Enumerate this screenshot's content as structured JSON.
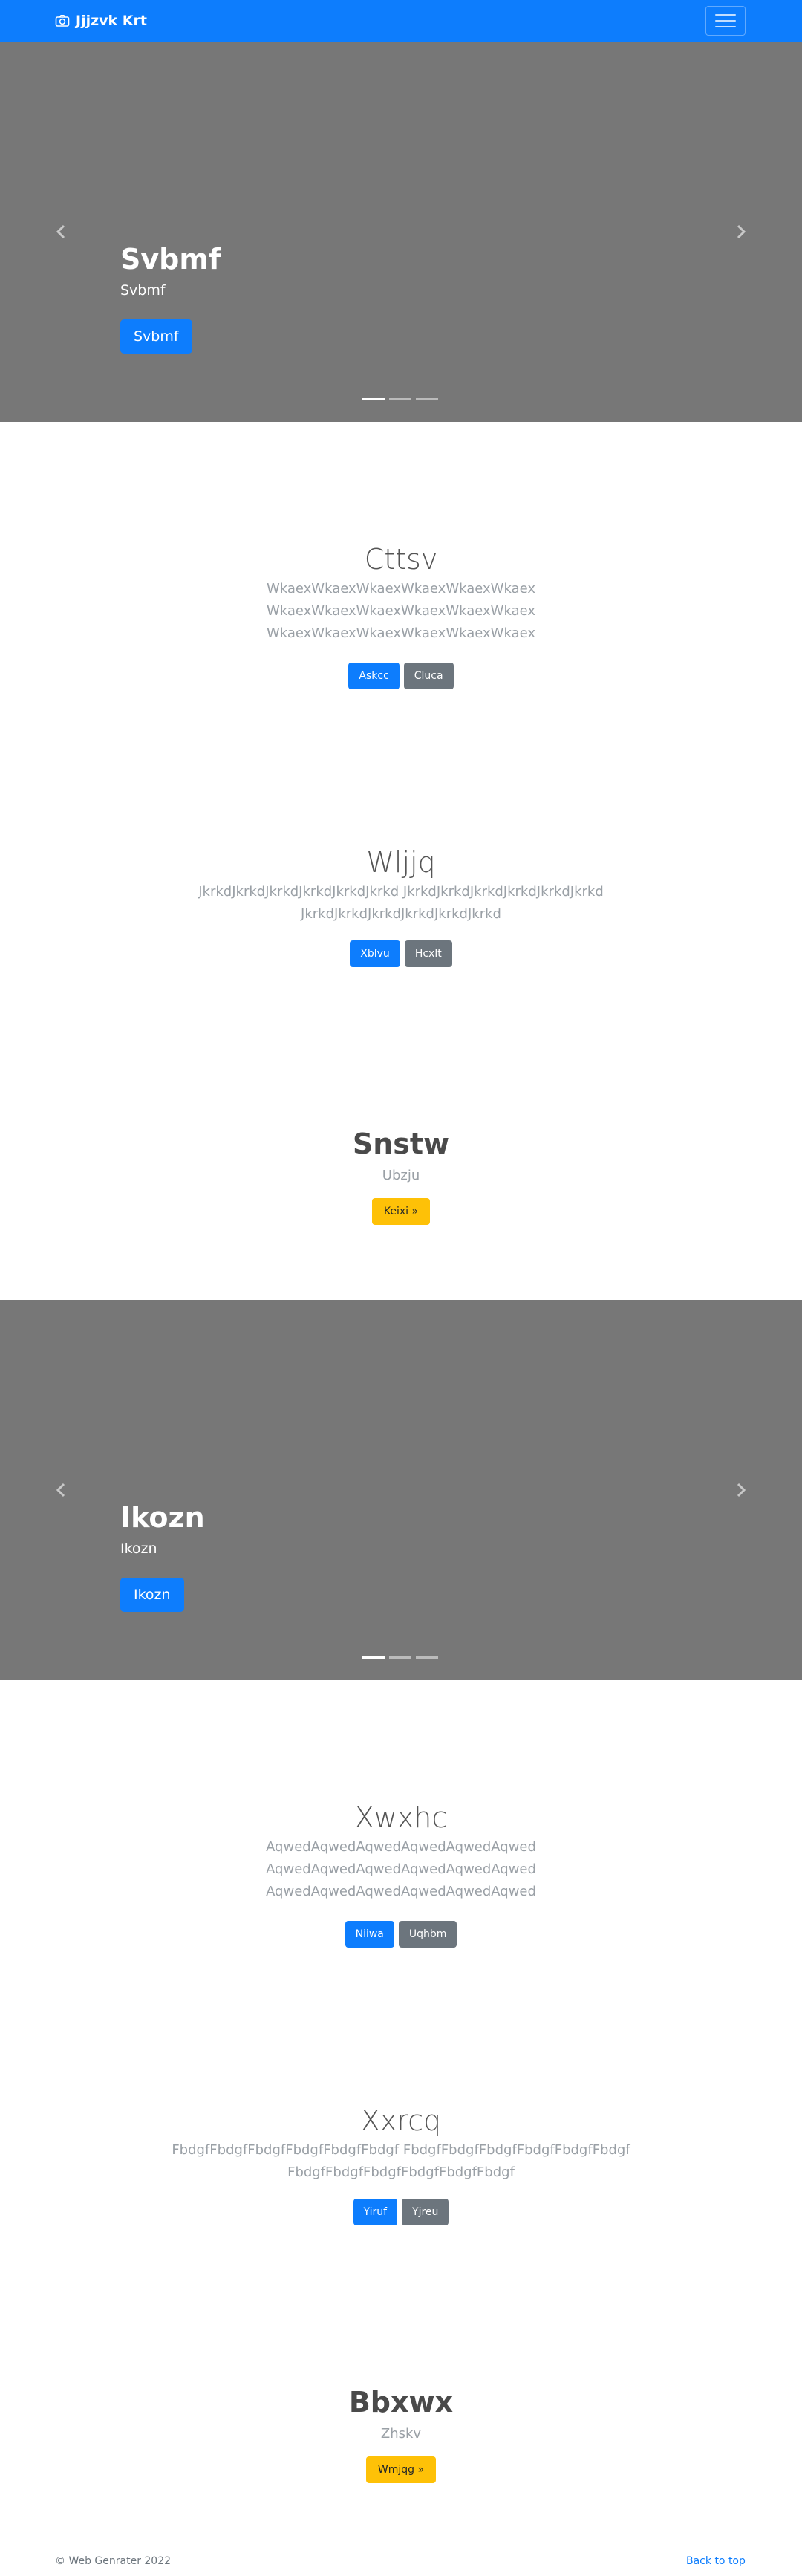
{
  "navbar": {
    "brand_icon": "camera-icon",
    "brand": "Jjjzvk Krt",
    "toggler_icon": "hamburger-menu-icon"
  },
  "carousel1": {
    "title": "Svbmf",
    "subtitle": "Svbmf",
    "button": "Svbmf",
    "prev_icon": "chevron-left-icon",
    "next_icon": "chevron-right-icon",
    "active_slide": 1,
    "slide_count": 3
  },
  "section1": {
    "title": "Cttsv",
    "lines": [
      "WkaexWkaexWkaexWkaexWkaexWkaex",
      "WkaexWkaexWkaexWkaexWkaexWkaex",
      "WkaexWkaexWkaexWkaexWkaexWkaex"
    ],
    "primary": "Askcc",
    "secondary": "Cluca"
  },
  "section2": {
    "title": "Wljjq",
    "lines": [
      "JkrkdJkrkdJkrkdJkrkdJkrkdJkrkd JkrkdJkrkdJkrkdJkrkdJkrkdJkrkd",
      "JkrkdJkrkdJkrkdJkrkdJkrkdJkrkd"
    ],
    "primary": "Xblvu",
    "secondary": "Hcxlt"
  },
  "section3": {
    "title": "Snstw",
    "text": "Ubzju",
    "button": "Keixi »"
  },
  "carousel2": {
    "title": "Ikozn",
    "subtitle": "Ikozn",
    "button": "Ikozn",
    "prev_icon": "chevron-left-icon",
    "next_icon": "chevron-right-icon",
    "active_slide": 1,
    "slide_count": 3
  },
  "section4": {
    "title": "Xwxhc",
    "lines": [
      "AqwedAqwedAqwedAqwedAqwedAqwed",
      "AqwedAqwedAqwedAqwedAqwedAqwed",
      "AqwedAqwedAqwedAqwedAqwedAqwed"
    ],
    "primary": "Niiwa",
    "secondary": "Uqhbm"
  },
  "section5": {
    "title": "Xxrcq",
    "lines": [
      "FbdgfFbdgfFbdgfFbdgfFbdgfFbdgf FbdgfFbdgfFbdgfFbdgfFbdgfFbdgf",
      "FbdgfFbdgfFbdgfFbdgfFbdgfFbdgf"
    ],
    "primary": "Yiruf",
    "secondary": "Yjreu"
  },
  "section6": {
    "title": "Bbxwx",
    "text": "Zhskv",
    "button": "Wmjqg »"
  },
  "footer": {
    "copyright": "© Web Genrater 2022",
    "back_to_top": "Back to top"
  },
  "colors": {
    "primary": "#0d7dfd",
    "secondary": "#6c757d",
    "warning": "#fec107",
    "carousel_bg": "#777777"
  }
}
